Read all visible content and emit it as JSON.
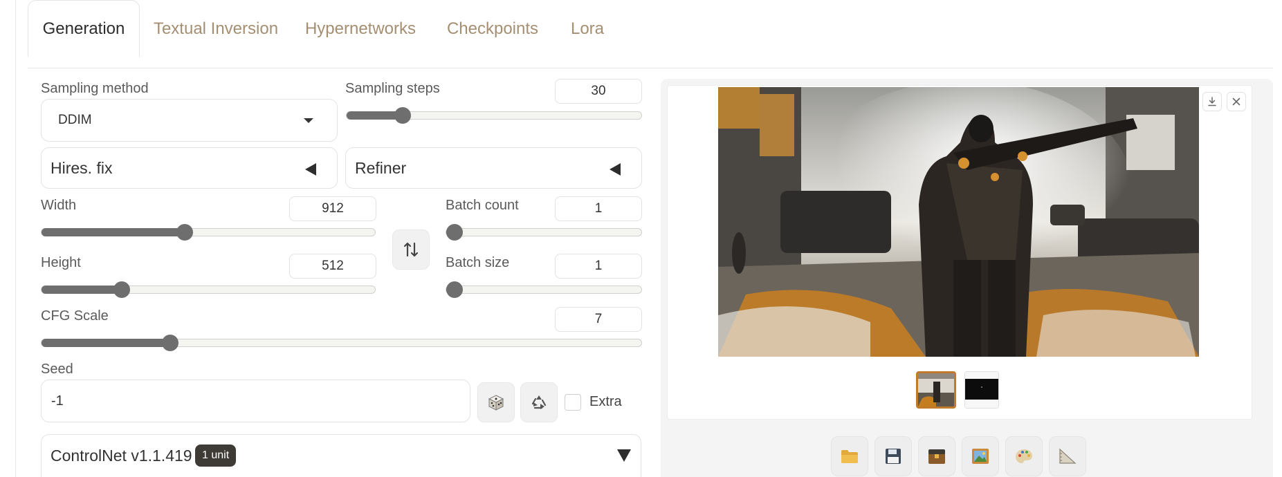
{
  "tabs": [
    {
      "label": "Generation",
      "active": true
    },
    {
      "label": "Textual Inversion",
      "active": false
    },
    {
      "label": "Hypernetworks",
      "active": false
    },
    {
      "label": "Checkpoints",
      "active": false
    },
    {
      "label": "Lora",
      "active": false
    }
  ],
  "sampling": {
    "method_label": "Sampling method",
    "method_value": "DDIM",
    "steps_label": "Sampling steps",
    "steps_value": "30",
    "steps_fraction": 0.19
  },
  "accordions": {
    "hires": "Hires. fix",
    "refiner": "Refiner"
  },
  "dimensions": {
    "width_label": "Width",
    "width_value": "912",
    "width_fraction": 0.43,
    "height_label": "Height",
    "height_value": "512",
    "height_fraction": 0.24
  },
  "batch": {
    "count_label": "Batch count",
    "count_value": "1",
    "count_fraction": 0.0,
    "size_label": "Batch size",
    "size_value": "1",
    "size_fraction": 0.0
  },
  "cfg": {
    "label": "CFG Scale",
    "value": "7",
    "fraction": 0.215
  },
  "seed": {
    "label": "Seed",
    "value": "-1",
    "extra_label": "Extra"
  },
  "controlnet": {
    "title": "ControlNet v1.1.419",
    "badge": "1 unit"
  },
  "icons": {
    "swap": "swap-vertical-icon",
    "dice": "dice-icon",
    "recycle": "recycle-icon",
    "download": "download-icon",
    "close": "close-icon",
    "tools": [
      "folder-icon",
      "save-icon",
      "zip-icon",
      "image-icon",
      "palette-icon",
      "ruler-icon"
    ]
  },
  "colors": {
    "accent": "#c07a2a",
    "slider": "#6e6e6e",
    "tab_inactive": "#a58f72"
  }
}
